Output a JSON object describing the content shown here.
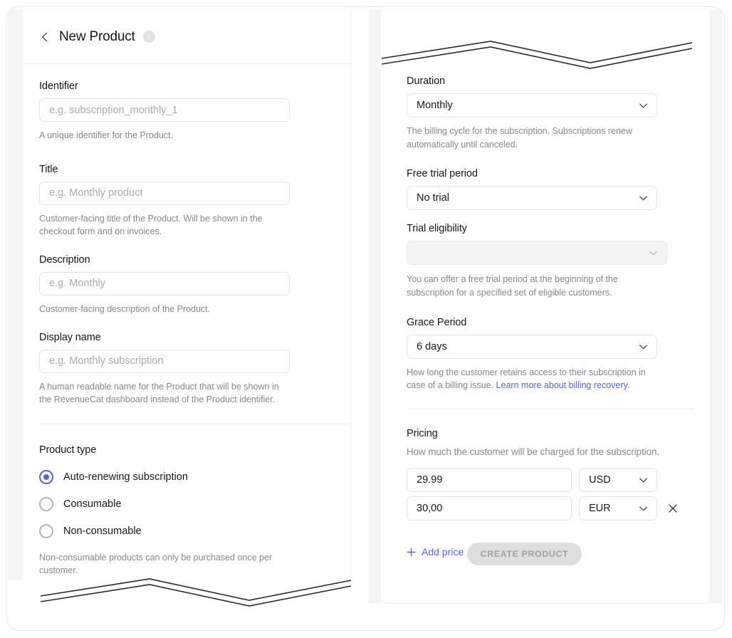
{
  "header": {
    "back_icon": "chevron-left-icon",
    "title": "New Product",
    "info_icon": "info-icon",
    "info_label": "i"
  },
  "left_column": {
    "fields": [
      {
        "label": "Identifier",
        "placeholder": "e.g. subscription_monthly_1",
        "value": "",
        "helper": "A unique identifier for the Product."
      },
      {
        "label": "Title",
        "placeholder": "e.g. Monthly product",
        "value": "",
        "helper": "Customer-facing title of the Product. Will be shown in the checkout form and on invoices."
      },
      {
        "label": "Description",
        "placeholder": "e.g. Monthly",
        "value": "",
        "helper": "Customer-facing description of the Product."
      },
      {
        "label": "Display name",
        "placeholder": "e.g. Monthly subscription",
        "value": "",
        "helper": "A human readable name for the Product that will be shown in the RevenueCat dashboard instead of the Product identifier."
      }
    ],
    "product_type": {
      "label": "Product type",
      "options": [
        {
          "label": "Auto-renewing subscription",
          "selected": true
        },
        {
          "label": "Consumable",
          "selected": false
        },
        {
          "label": "Non-consumable",
          "selected": false
        }
      ],
      "helper": "Non-consumable products can only be purchased once per customer."
    }
  },
  "right_column": {
    "duration": {
      "label": "Duration",
      "value": "Monthly",
      "helper": "The billing cycle for the subscription. Subscriptions renew automatically until canceled."
    },
    "free_trial": {
      "label": "Free trial period",
      "value": "No trial"
    },
    "trial_eligibility": {
      "label": "Trial eligibility",
      "value": "",
      "disabled": true,
      "helper": "You can offer a free trial period at the beginning of the subscription for a specified set of eligible customers."
    },
    "grace_period": {
      "label": "Grace Period",
      "value": "6 days",
      "helper_prefix": "How long the customer retains access to their subscription in case of a billing issue. ",
      "helper_link": "Learn more about billing recovery."
    },
    "pricing": {
      "label": "Pricing",
      "helper": "How much the customer will be charged for the subscription.",
      "rows": [
        {
          "amount": "29.99",
          "currency": "USD",
          "removable": false
        },
        {
          "amount": "30,00",
          "currency": "EUR",
          "removable": true
        }
      ],
      "add_price_label": "Add price",
      "add_icon": "plus-icon",
      "remove_icon": "close-icon"
    },
    "submit": {
      "label": "CREATE PRODUCT",
      "disabled": true
    }
  },
  "decorations": {
    "zigzag_top_right": "torn-edge-zigzag",
    "zigzag_bottom_left": "torn-edge-zigzag"
  },
  "colors": {
    "accent": "#5566d6",
    "link": "#5566d6",
    "text": "#16161a",
    "helper_text": "#87878f",
    "border": "#e4e4e7",
    "disabled_bg": "#f4f4f6",
    "button_disabled_bg": "#dededf"
  }
}
